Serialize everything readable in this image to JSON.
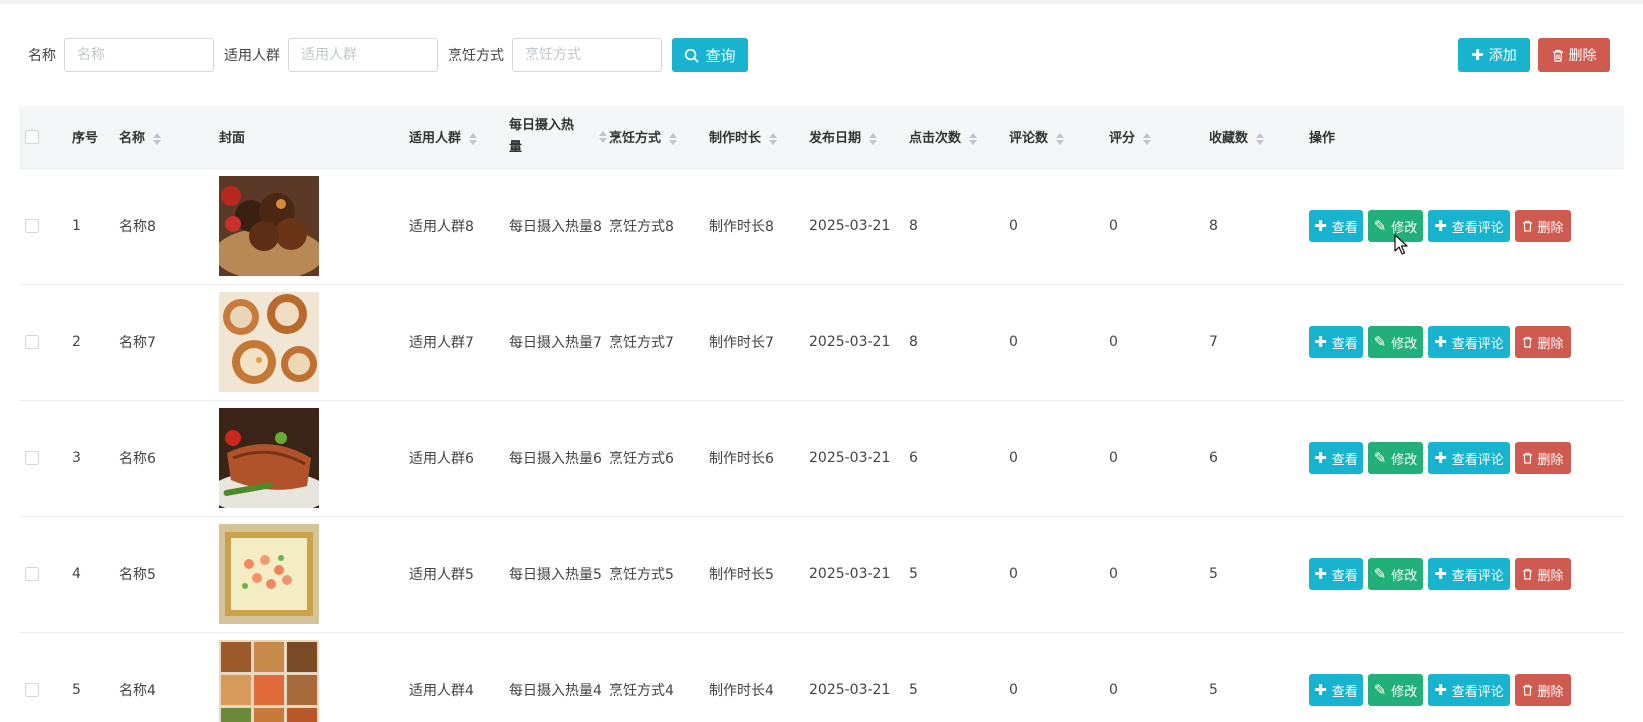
{
  "search": {
    "name_label": "名称",
    "name_placeholder": "名称",
    "crowd_label": "适用人群",
    "crowd_placeholder": "适用人群",
    "cooking_label": "烹饪方式",
    "cooking_placeholder": "烹饪方式",
    "query_label": "查询"
  },
  "toolbar": {
    "add_label": "添加",
    "delete_label": "删除"
  },
  "table": {
    "headers": {
      "index": "序号",
      "name": "名称",
      "cover": "封面",
      "crowd": "适用人群",
      "calories_line1": "每日摄入热",
      "calories_line2": "量",
      "cooking": "烹饪方式",
      "duration": "制作时长",
      "date": "发布日期",
      "clicks": "点击次数",
      "comments": "评论数",
      "rating": "评分",
      "favorites": "收藏数",
      "actions": "操作"
    },
    "row_actions": {
      "view": "查看",
      "edit": "修改",
      "view_comments": "查看评论",
      "delete": "删除"
    },
    "rows": [
      {
        "index": "1",
        "name": "名称8",
        "crowd": "适用人群8",
        "calories": "每日摄入热量8",
        "cooking": "烹饪方式8",
        "duration": "制作时长8",
        "date": "2025-03-21",
        "clicks": "8",
        "comments": "0",
        "rating": "0",
        "favorites": "8"
      },
      {
        "index": "2",
        "name": "名称7",
        "crowd": "适用人群7",
        "calories": "每日摄入热量7",
        "cooking": "烹饪方式7",
        "duration": "制作时长7",
        "date": "2025-03-21",
        "clicks": "8",
        "comments": "0",
        "rating": "0",
        "favorites": "7"
      },
      {
        "index": "3",
        "name": "名称6",
        "crowd": "适用人群6",
        "calories": "每日摄入热量6",
        "cooking": "烹饪方式6",
        "duration": "制作时长6",
        "date": "2025-03-21",
        "clicks": "6",
        "comments": "0",
        "rating": "0",
        "favorites": "6"
      },
      {
        "index": "4",
        "name": "名称5",
        "crowd": "适用人群5",
        "calories": "每日摄入热量5",
        "cooking": "烹饪方式5",
        "duration": "制作时长5",
        "date": "2025-03-21",
        "clicks": "5",
        "comments": "0",
        "rating": "0",
        "favorites": "5"
      },
      {
        "index": "5",
        "name": "名称4",
        "crowd": "适用人群4",
        "calories": "每日摄入热量4",
        "cooking": "烹饪方式4",
        "duration": "制作时长4",
        "date": "2025-03-21",
        "clicks": "5",
        "comments": "0",
        "rating": "0",
        "favorites": "5"
      }
    ]
  },
  "colors": {
    "primary": "#17b3cf",
    "success": "#22b07a",
    "danger": "#cf5b50"
  }
}
